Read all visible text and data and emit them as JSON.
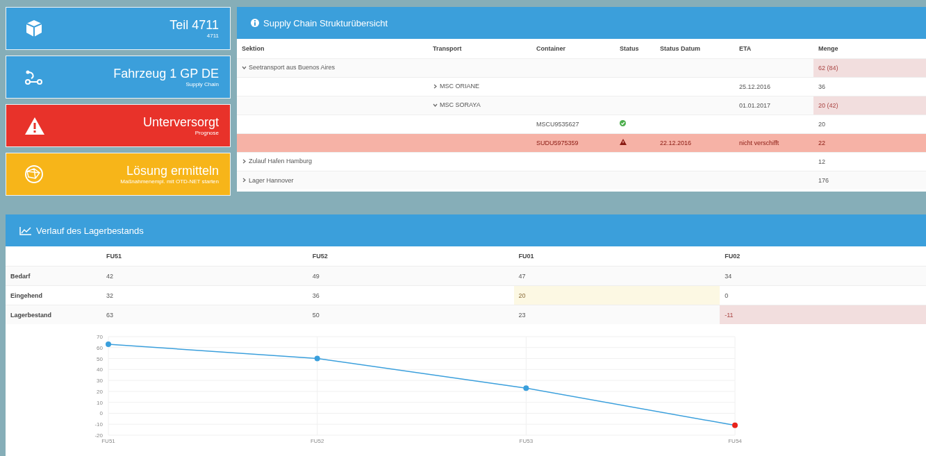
{
  "tiles": [
    {
      "kind": "box",
      "title": "Teil 4711",
      "subtitle": "4711",
      "color": "#3b9fdb"
    },
    {
      "kind": "route",
      "title": "Fahrzeug 1 GP DE",
      "subtitle": "Supply Chain",
      "color": "#3b9fdb"
    },
    {
      "kind": "warning",
      "title": "Unterversorgt",
      "subtitle": "Prognose",
      "color": "#e8322a"
    },
    {
      "kind": "globe",
      "title": "Lösung ermitteln",
      "subtitle": "Maßnahmenempl. mit OTD-NET starten",
      "color": "#f7b519"
    }
  ],
  "structure": {
    "title": "Supply Chain Strukturübersicht",
    "columns": [
      "Sektion",
      "Transport",
      "Container",
      "Status",
      "Status Datum",
      "ETA",
      "Menge"
    ],
    "rows": [
      {
        "section": "Seetransport aus Buenos Aires",
        "expanded": true,
        "menge": "62 (84)",
        "menge_alert": true,
        "alert": false,
        "children": [
          {
            "transport": "MSC ORIANE",
            "expanded": false,
            "eta": "25.12.2016",
            "menge": "36",
            "menge_alert": false,
            "alert": false
          },
          {
            "transport": "MSC SORAYA",
            "expanded": true,
            "eta": "01.01.2017",
            "menge": "20 (42)",
            "menge_alert": true,
            "alert": false,
            "children": [
              {
                "container": "MSCU9535627",
                "status_ok": true,
                "menge": "20",
                "menge_alert": false,
                "alert": false
              },
              {
                "container": "SUDU5975359",
                "status_ok": false,
                "status_datum": "22.12.2016",
                "eta": "nicht verschifft",
                "menge": "22",
                "menge_alert": false,
                "alert": true
              }
            ]
          }
        ]
      },
      {
        "section": "Zulauf Hafen Hamburg",
        "expanded": false,
        "menge": "12",
        "menge_alert": false,
        "alert": false
      },
      {
        "section": "Lager Hannover",
        "expanded": false,
        "menge": "176",
        "menge_alert": false,
        "alert": false
      }
    ]
  },
  "stock": {
    "title": "Verlauf des Lagerbestands",
    "columns": [
      "FU51",
      "FU52",
      "FU01",
      "FU02"
    ],
    "rows": [
      {
        "label": "Bedarf",
        "cells": [
          {
            "value": "42",
            "warning": false,
            "danger": false
          },
          {
            "value": "49",
            "warning": false,
            "danger": false
          },
          {
            "value": "47",
            "warning": false,
            "danger": false
          },
          {
            "value": "34",
            "warning": false,
            "danger": false
          }
        ]
      },
      {
        "label": "Eingehend",
        "cells": [
          {
            "value": "32",
            "warning": false,
            "danger": false
          },
          {
            "value": "36",
            "warning": false,
            "danger": false
          },
          {
            "value": "20",
            "warning": true,
            "danger": false
          },
          {
            "value": "0",
            "warning": false,
            "danger": false
          }
        ]
      },
      {
        "label": "Lagerbestand",
        "cells": [
          {
            "value": "63",
            "warning": false,
            "danger": false
          },
          {
            "value": "50",
            "warning": false,
            "danger": false
          },
          {
            "value": "23",
            "warning": false,
            "danger": false
          },
          {
            "value": "-11",
            "warning": false,
            "danger": true
          }
        ]
      }
    ],
    "chart_data": {
      "type": "line",
      "categories": [
        "FU51",
        "FU52",
        "FU53",
        "FU54"
      ],
      "series": [
        {
          "color": "#3a9fdc",
          "marker": "circle",
          "values": [
            63,
            50,
            23,
            -11
          ]
        }
      ],
      "ylim": [
        -20,
        70
      ],
      "yticks": [
        -20,
        -10,
        0,
        10,
        20,
        30,
        40,
        50,
        60,
        70
      ],
      "grid": true
    }
  }
}
